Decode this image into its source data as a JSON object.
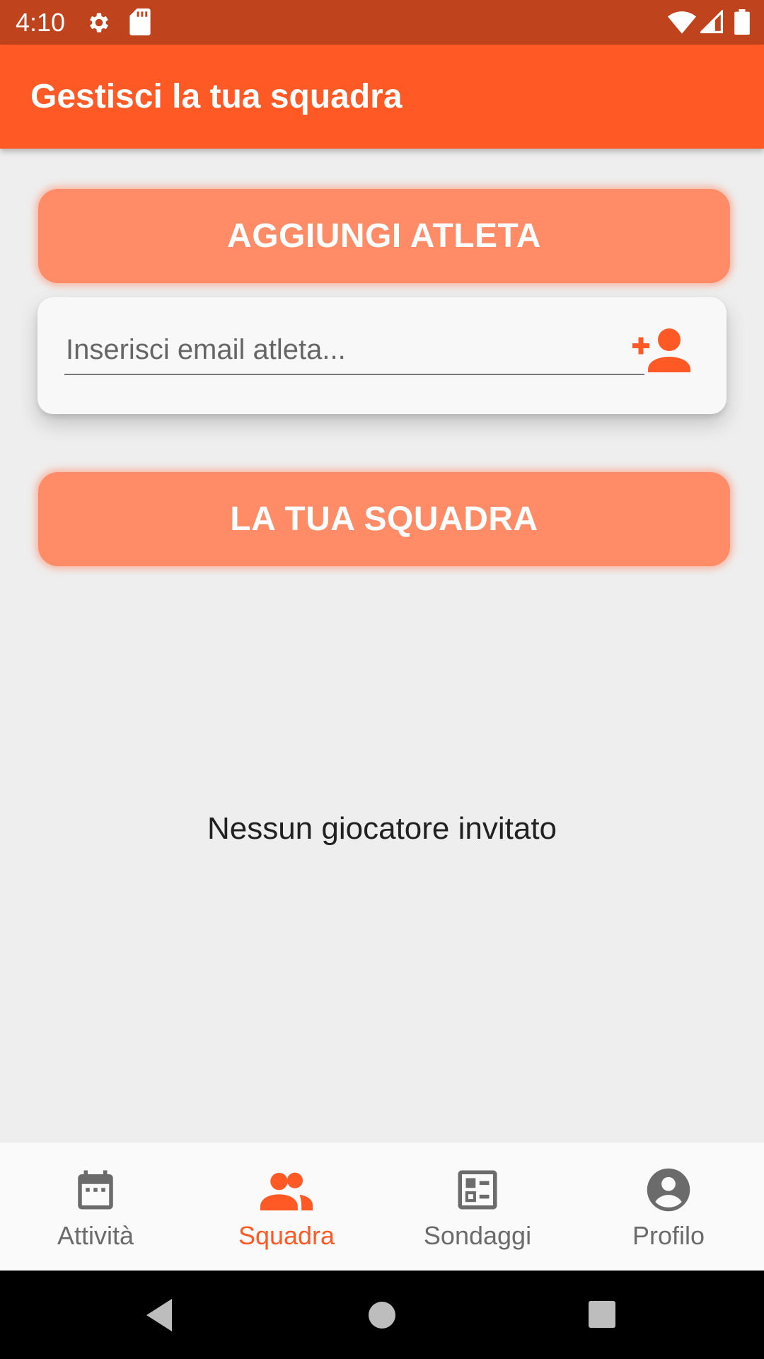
{
  "status_bar": {
    "time": "4:10",
    "icons": [
      "settings-gear-icon",
      "sd-card-icon",
      "wifi-icon",
      "signal-icon",
      "battery-icon"
    ]
  },
  "app_bar": {
    "title": "Gestisci la tua squadra"
  },
  "colors": {
    "primary": "#ff5a26",
    "status_bar": "#bf431c",
    "section_button": "#ff8b67",
    "background": "#eeeeee"
  },
  "add_athlete": {
    "button_label": "AGGIUNGI ATLETA",
    "email_placeholder": "Inserisci email atleta...",
    "email_value": "",
    "add_icon": "person-add-icon"
  },
  "team": {
    "button_label": "LA TUA SQUADRA",
    "empty_message": "Nessun giocatore invitato"
  },
  "bottom_nav": {
    "selected": "Squadra",
    "items": [
      {
        "label": "Attività",
        "icon": "calendar-icon"
      },
      {
        "label": "Squadra",
        "icon": "group-icon"
      },
      {
        "label": "Sondaggi",
        "icon": "poll-icon"
      },
      {
        "label": "Profilo",
        "icon": "account-circle-icon"
      }
    ]
  },
  "system_nav": [
    "back-icon",
    "home-icon",
    "recents-icon"
  ]
}
